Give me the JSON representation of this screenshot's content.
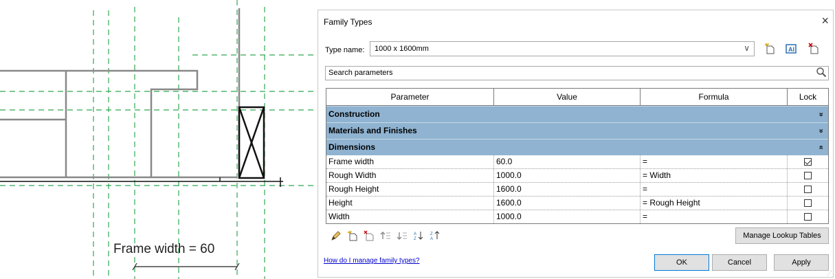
{
  "drawing": {
    "annotation": "Frame width = 60"
  },
  "dialog": {
    "title": "Family Types",
    "close_glyph": "×",
    "type_name_label": "Type name:",
    "type_name_value": "1000 x 1600mm",
    "dropdown_glyph": "∨",
    "toolbar_icons": [
      "new-type-icon",
      "rename-type-icon",
      "delete-type-icon"
    ],
    "search_text": "Search parameters",
    "columns": [
      "Parameter",
      "Value",
      "Formula",
      "Lock"
    ],
    "groups": [
      {
        "name": "Construction",
        "chevron": "»",
        "expanded": false
      },
      {
        "name": "Materials and Finishes",
        "chevron": "»",
        "expanded": false
      },
      {
        "name": "Dimensions",
        "chevron": "«",
        "expanded": true
      }
    ],
    "rows": [
      {
        "parameter": "Frame width",
        "value": "60.0",
        "formula": "=",
        "lock": true
      },
      {
        "parameter": "Rough Width",
        "value": "1000.0",
        "formula": "= Width",
        "lock": false
      },
      {
        "parameter": "Rough Height",
        "value": "1600.0",
        "formula": "=",
        "lock": false
      },
      {
        "parameter": "Height",
        "value": "1600.0",
        "formula": "= Rough Height",
        "lock": false
      },
      {
        "parameter": "Width",
        "value": "1000.0",
        "formula": "=",
        "lock": false
      }
    ],
    "bottom_tools": [
      "edit-pencil-icon",
      "new-parameter-icon",
      "delete-parameter-icon",
      "move-up-icon",
      "move-down-icon",
      "sort-ascending-icon",
      "sort-descending-icon"
    ],
    "manage_lookup_label": "Manage Lookup Tables",
    "help_link": "How do I manage family types?",
    "ok_label": "OK",
    "cancel_label": "Cancel",
    "apply_label": "Apply",
    "colors": {
      "group_header": "#8fb3d1",
      "link": "#0000cc",
      "ok_border": "#0078d7",
      "cad_dashed": "#22aa44"
    }
  }
}
